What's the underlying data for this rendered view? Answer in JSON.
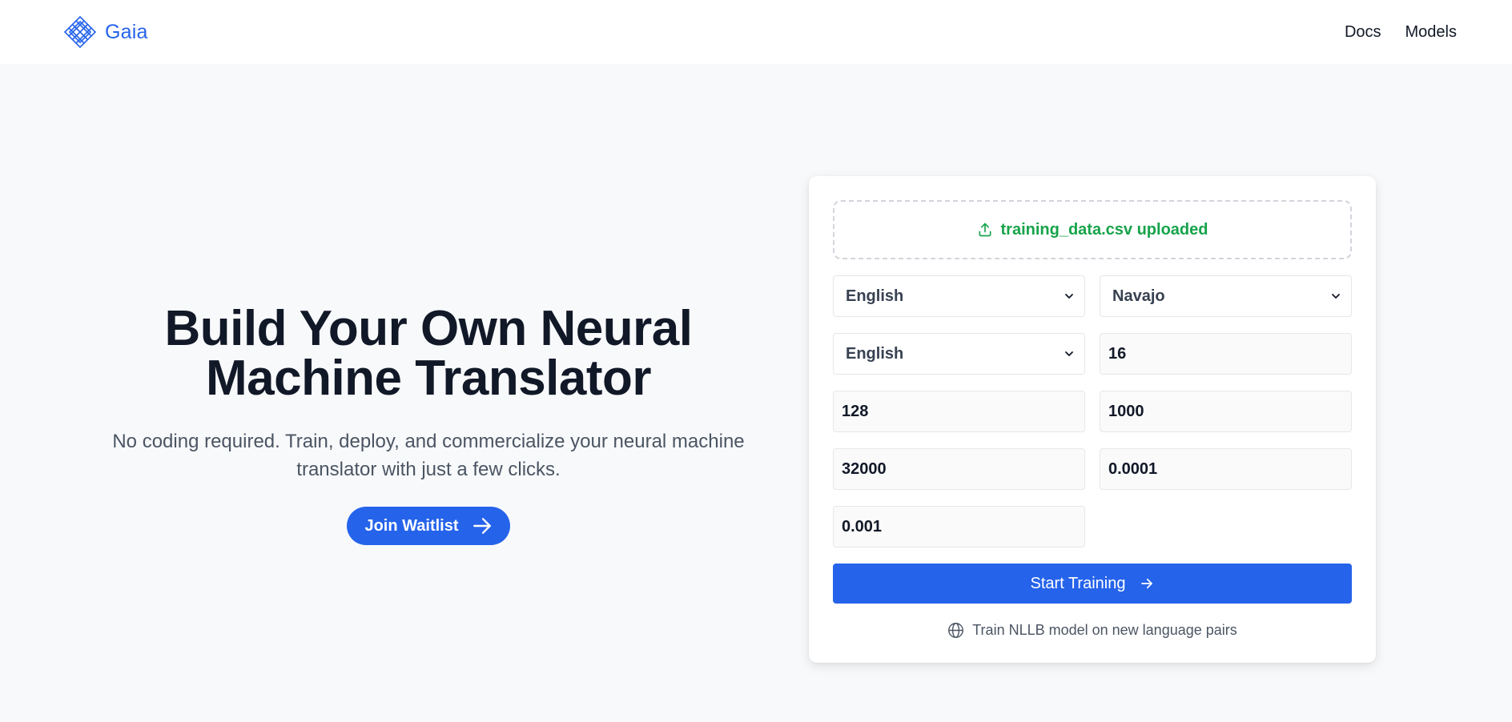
{
  "navbar": {
    "brand_name": "Gaia",
    "brand_icon": "diamond-grid-logo-icon",
    "links": [
      {
        "label": "Docs"
      },
      {
        "label": "Models"
      }
    ]
  },
  "hero": {
    "title_line1": "Build Your Own Neural",
    "title_line2": "Machine Translator",
    "subtitle": "No coding required. Train, deploy, and commercialize your neural machine translator with just a few clicks.",
    "cta_label": "Join Waitlist",
    "cta_icon": "arrow-right-icon"
  },
  "training_form": {
    "upload": {
      "status_text": "training_data.csv uploaded",
      "icon": "upload-icon"
    },
    "source_language": {
      "selected": "English"
    },
    "target_language": {
      "selected": "Navajo"
    },
    "third_select": {
      "selected": "English"
    },
    "param_1": {
      "value": "16"
    },
    "param_2": {
      "value": "128"
    },
    "param_3": {
      "value": "1000"
    },
    "param_4": {
      "value": "32000"
    },
    "param_5": {
      "value": "0.0001"
    },
    "param_6": {
      "value": "0.001"
    },
    "submit_label": "Start Training",
    "footnote": "Train NLLB model on new language pairs",
    "footnote_icon": "globe-icon"
  },
  "colors": {
    "accent": "#2563eb",
    "success": "#16a34a",
    "text_dark": "#111827",
    "text_muted": "#4b5563",
    "page_bg": "#f8f9fb"
  }
}
